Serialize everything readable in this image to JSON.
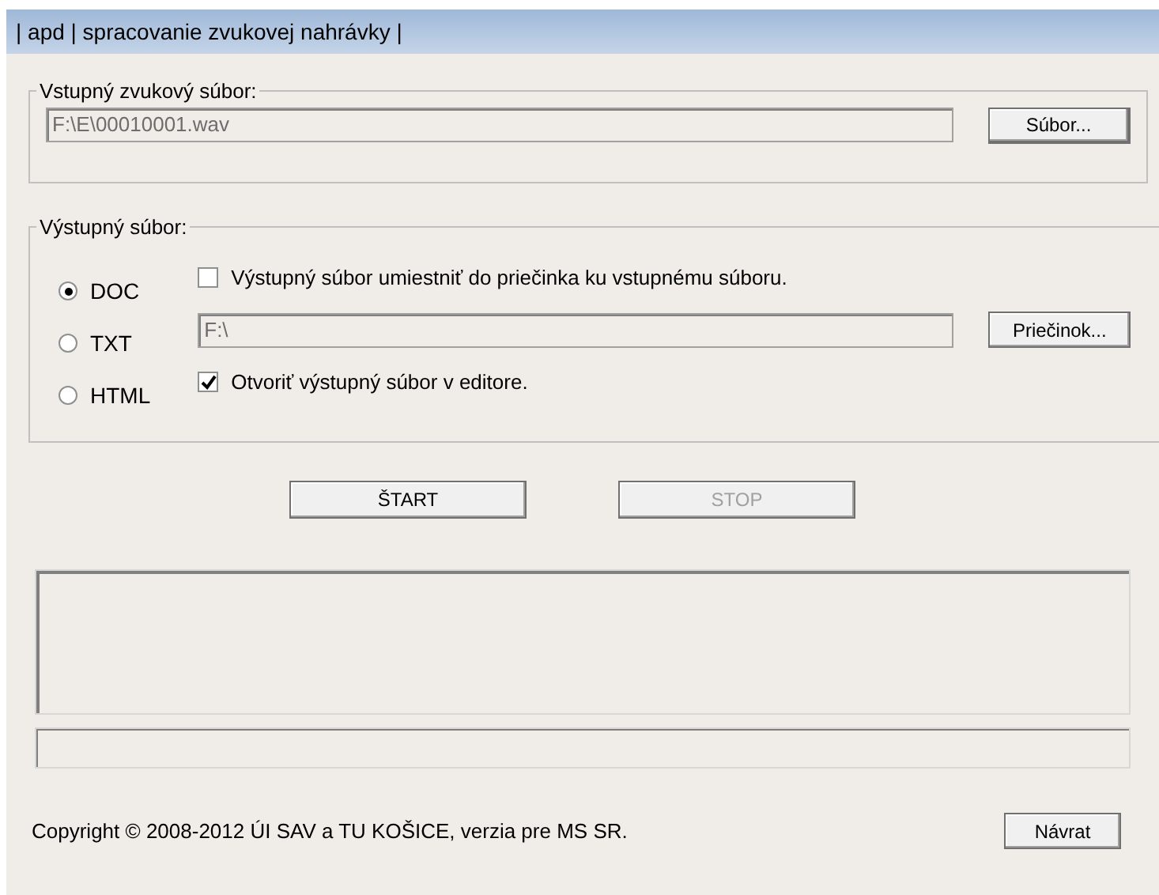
{
  "window": {
    "title": "| apd | spracovanie zvukovej nahrávky |"
  },
  "input_group": {
    "legend": "Vstupný zvukový súbor:",
    "path": "F:\\E\\00010001.wav",
    "button": "Súbor..."
  },
  "output_group": {
    "legend": "Výstupný súbor:",
    "formats": [
      {
        "label": "DOC",
        "selected": true
      },
      {
        "label": "TXT",
        "selected": false
      },
      {
        "label": "HTML",
        "selected": false
      }
    ],
    "same_folder": {
      "label": "Výstupný súbor umiestniť do priečinka ku vstupnému súboru.",
      "checked": false
    },
    "folder": "F:\\",
    "folder_button": "Priečinok...",
    "open_editor": {
      "label": "Otvoriť výstupný súbor v editore.",
      "checked": true
    }
  },
  "actions": [
    {
      "label": "ŠTART",
      "disabled": false
    },
    {
      "label": "STOP",
      "disabled": true
    }
  ],
  "footer": {
    "copyright": "Copyright © 2008-2012 ÚI SAV a TU KOŠICE, verzia pre MS SR.",
    "button": "Návrat"
  }
}
